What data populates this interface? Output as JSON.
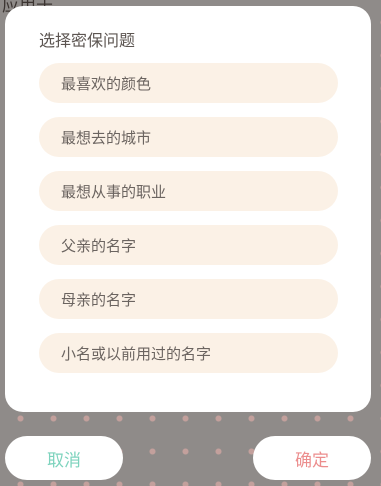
{
  "background": {
    "partial_text": "应用于"
  },
  "dialog": {
    "title": "选择密保问题",
    "options": [
      {
        "label": "最喜欢的颜色"
      },
      {
        "label": "最想去的城市"
      },
      {
        "label": "最想从事的职业"
      },
      {
        "label": "父亲的名字"
      },
      {
        "label": "母亲的名字"
      },
      {
        "label": "小名或以前用过的名字"
      }
    ]
  },
  "footer": {
    "cancel_label": "取消",
    "confirm_label": "确定"
  },
  "colors": {
    "option_bg": "#fbf1e6",
    "cancel_text": "#7dd3bd",
    "confirm_text": "#ec8d8d",
    "overlay": "#8f8b89"
  }
}
